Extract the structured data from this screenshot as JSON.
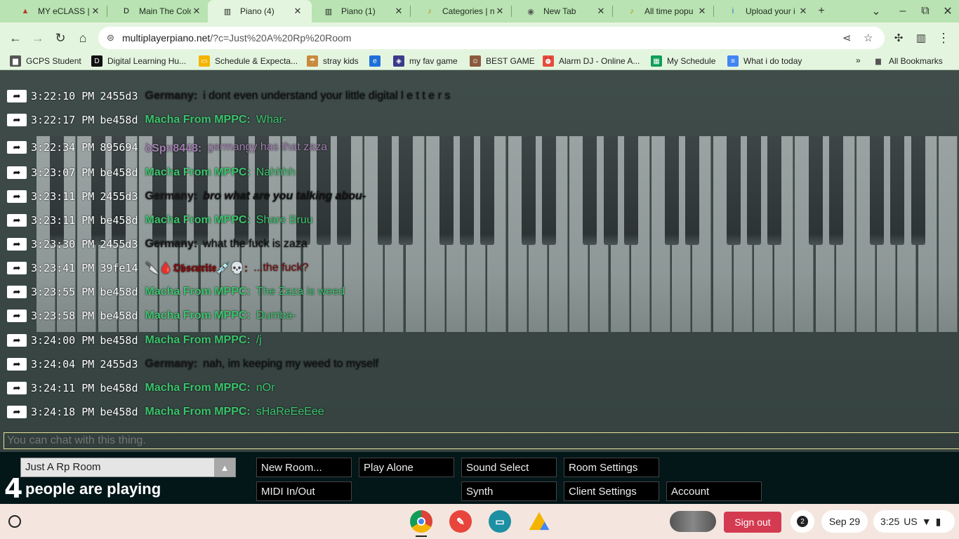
{
  "tabs": [
    {
      "title": "MY eCLASS | G",
      "icon": "eclass-icon",
      "active": false
    },
    {
      "title": "Main The Colo",
      "icon": "d2l-icon",
      "active": false
    },
    {
      "title": "Piano (4)",
      "icon": "piano-icon",
      "active": true
    },
    {
      "title": "Piano (1)",
      "icon": "piano-icon",
      "active": false
    },
    {
      "title": "Categories | n",
      "icon": "music-note-icon",
      "active": false
    },
    {
      "title": "New Tab",
      "icon": "chrome-icon",
      "active": false
    },
    {
      "title": "All time popu",
      "icon": "music-note-icon",
      "active": false
    },
    {
      "title": "Upload your i",
      "icon": "ibb-icon",
      "active": false
    }
  ],
  "address_bar": {
    "domain": "multiplayerpiano.net",
    "path": "/?c=Just%20A%20Rp%20Room"
  },
  "bookmarks": [
    {
      "label": "GCPS Student",
      "icon": "folder-icon"
    },
    {
      "label": "Digital Learning Hu...",
      "icon": "d2l-icon"
    },
    {
      "label": "Schedule & Expecta...",
      "icon": "slides-icon"
    },
    {
      "label": "stray kids",
      "icon": "sk-icon"
    },
    {
      "label": "",
      "icon": "app-icon"
    },
    {
      "label": "my fav game",
      "icon": "game-icon"
    },
    {
      "label": "BEST GAME",
      "icon": "face-icon"
    },
    {
      "label": "Alarm DJ - Online A...",
      "icon": "alarm-icon"
    },
    {
      "label": "My Schedule",
      "icon": "sheets-icon"
    },
    {
      "label": "What i do today",
      "icon": "docs-icon"
    }
  ],
  "bookmarks_overflow": "»",
  "all_bookmarks": "All Bookmarks",
  "chat": {
    "messages": [
      {
        "time": "3:22:10 PM",
        "id": "2455d3",
        "name": "Germany:",
        "text": "i dont even understand your little digital l e t t e r s",
        "name_color": "#1b1b1b",
        "text_color": "#141414",
        "italic": false
      },
      {
        "time": "3:22:17 PM",
        "id": "be458d",
        "name": "Macha From MPPC:",
        "text": "Whar-",
        "name_color": "#3cc46d",
        "text_color": "#3cc46d",
        "italic": false
      },
      {
        "time": "3:22:34 PM",
        "id": "895694",
        "name": "ꝺSpn8448:",
        "text": "germangy has that zaza",
        "name_color": "#a17fb0",
        "text_color": "#a17fb0",
        "italic": false
      },
      {
        "time": "3:23:07 PM",
        "id": "be458d",
        "name": "Macha From MPPC:",
        "text": "Nahhhh",
        "name_color": "#3cc46d",
        "text_color": "#3cc46d",
        "italic": false
      },
      {
        "time": "3:23:11 PM",
        "id": "2455d3",
        "name": "Germany:",
        "text": "bro what are you talking abou-",
        "name_color": "#1b1b1b",
        "text_color": "#141414",
        "italic": true
      },
      {
        "time": "3:23:11 PM",
        "id": "be458d",
        "name": "Macha From MPPC:",
        "text": "Share Bruu",
        "name_color": "#3cc46d",
        "text_color": "#3cc46d",
        "italic": false
      },
      {
        "time": "3:23:30 PM",
        "id": "2455d3",
        "name": "Germany:",
        "text": "what the fuck is zaza",
        "name_color": "#1b1b1b",
        "text_color": "#141414",
        "italic": false
      },
      {
        "time": "3:23:41 PM",
        "id": "39fe14",
        "name": "🔪🩸𝕺𝖇𝖘𝖈𝖚𝖗𝖎𝖙𝖊💉💀:",
        "text": "...the fuck?",
        "name_color": "#7a1010",
        "text_color": "#7a1010",
        "italic": false
      },
      {
        "time": "3:23:55 PM",
        "id": "be458d",
        "name": "Macha From MPPC:",
        "text": "The Zaza is weed",
        "name_color": "#3cc46d",
        "text_color": "#3cc46d",
        "italic": false
      },
      {
        "time": "3:23:58 PM",
        "id": "be458d",
        "name": "Macha From MPPC:",
        "text": "Dumba-",
        "name_color": "#3cc46d",
        "text_color": "#3cc46d",
        "italic": false
      },
      {
        "time": "3:24:00 PM",
        "id": "be458d",
        "name": "Macha From MPPC:",
        "text": "/j",
        "name_color": "#3cc46d",
        "text_color": "#3cc46d",
        "italic": false
      },
      {
        "time": "3:24:04 PM",
        "id": "2455d3",
        "name": "Germany:",
        "text": "nah, im keeping my weed to myself",
        "name_color": "#1b1b1b",
        "text_color": "#141414",
        "italic": false
      },
      {
        "time": "3:24:11 PM",
        "id": "be458d",
        "name": "Macha From MPPC:",
        "text": "nOr",
        "name_color": "#3cc46d",
        "text_color": "#3cc46d",
        "italic": false
      },
      {
        "time": "3:24:18 PM",
        "id": "be458d",
        "name": "Macha From MPPC:",
        "text": "sHaReEeEee",
        "name_color": "#3cc46d",
        "text_color": "#3cc46d",
        "italic": false
      }
    ],
    "input_placeholder": "You can chat with this thing."
  },
  "room": {
    "name": "Just A Rp Room",
    "people_count": "4",
    "people_label": "people are playing"
  },
  "buttons": {
    "new_room": "New Room...",
    "play_alone": "Play Alone",
    "sound_select": "Sound Select",
    "room_settings": "Room Settings",
    "midi": "MIDI In/Out",
    "synth": "Synth",
    "client_settings": "Client Settings",
    "account": "Account"
  },
  "shelf": {
    "sign_out": "Sign out",
    "notifications": "2",
    "date": "Sep 29",
    "time": "3:25",
    "locale": "US"
  }
}
